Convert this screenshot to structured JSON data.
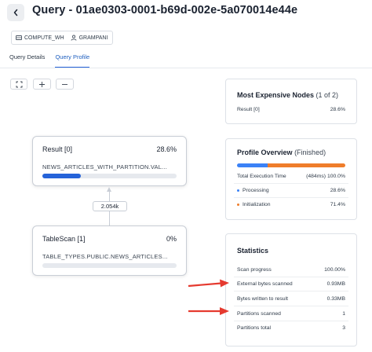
{
  "header": {
    "title": "Query - 01ae0303-0001-b69d-002e-5a070014e44e",
    "back_icon": "chevron-left-icon",
    "warehouse": "COMPUTE_WH",
    "user": "GRAMPANI"
  },
  "tabs": [
    {
      "label": "Query Details",
      "active": false
    },
    {
      "label": "Query Profile",
      "active": true
    }
  ],
  "toolbar": {
    "icons": [
      "fit-to-screen-icon",
      "zoom-in-icon",
      "zoom-out-icon"
    ]
  },
  "graph": {
    "nodes": [
      {
        "name": "Result",
        "id": "[0]",
        "percent": "28.6%",
        "detail": "NEWS_ARTICLES_WITH_PARTITION.VAL...",
        "bar_fraction": 0.286
      },
      {
        "name": "TableScan",
        "id": "[1]",
        "percent": "0%",
        "detail": "TABLE_TYPES.PUBLIC.NEWS_ARTICLES...",
        "bar_fraction": 0
      }
    ],
    "edge_label": "2.054k"
  },
  "most_expensive": {
    "title": "Most Expensive Nodes",
    "count": "(1 of 2)",
    "rows": [
      {
        "label": "Result [0]",
        "value": "28.6%"
      }
    ]
  },
  "profile_overview": {
    "title": "Profile Overview",
    "status": "(Finished)",
    "total_label": "Total Execution Time",
    "total_ms": "(484ms)",
    "total_pct": "100.0%",
    "processing_fraction": 0.286,
    "initialization_fraction": 0.714,
    "rows": [
      {
        "label": "Processing",
        "value": "28.6%",
        "color": "#3b82f6"
      },
      {
        "label": "Initialization",
        "value": "71.4%",
        "color": "#ef7d2b"
      }
    ]
  },
  "statistics": {
    "title": "Statistics",
    "rows": [
      {
        "label": "Scan progress",
        "value": "100.00%"
      },
      {
        "label": "External bytes scanned",
        "value": "0.93MB"
      },
      {
        "label": "Bytes written to result",
        "value": "0.33MB"
      },
      {
        "label": "Partitions scanned",
        "value": "1"
      },
      {
        "label": "Partitions total",
        "value": "3"
      }
    ]
  },
  "colors": {
    "accent": "#2563d9",
    "processing": "#3b82f6",
    "initialization": "#ef7d2b",
    "annotation_arrow": "#e53a2f"
  }
}
